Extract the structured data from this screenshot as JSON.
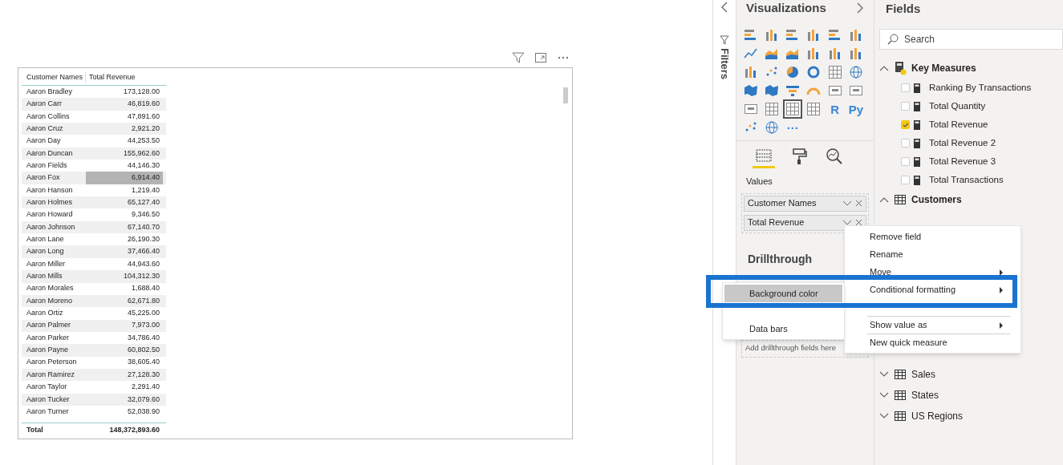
{
  "table": {
    "columns": [
      "Customer Names",
      "Total Revenue"
    ],
    "rows": [
      {
        "name": "Aaron Bradley",
        "value": "173,128.00",
        "selected": false
      },
      {
        "name": "Aaron Carr",
        "value": "46,819.60",
        "selected": false
      },
      {
        "name": "Aaron Collins",
        "value": "47,891.60",
        "selected": false
      },
      {
        "name": "Aaron Cruz",
        "value": "2,921.20",
        "selected": false
      },
      {
        "name": "Aaron Day",
        "value": "44,253.50",
        "selected": false
      },
      {
        "name": "Aaron Duncan",
        "value": "155,962.60",
        "selected": false
      },
      {
        "name": "Aaron Fields",
        "value": "44,146.30",
        "selected": false
      },
      {
        "name": "Aaron Fox",
        "value": "6,914.40",
        "selected": true
      },
      {
        "name": "Aaron Hanson",
        "value": "1,219.40",
        "selected": false
      },
      {
        "name": "Aaron Holmes",
        "value": "65,127.40",
        "selected": false
      },
      {
        "name": "Aaron Howard",
        "value": "9,346.50",
        "selected": false
      },
      {
        "name": "Aaron Johnson",
        "value": "67,140.70",
        "selected": false
      },
      {
        "name": "Aaron Lane",
        "value": "26,190.30",
        "selected": false
      },
      {
        "name": "Aaron Long",
        "value": "37,466.40",
        "selected": false
      },
      {
        "name": "Aaron Miller",
        "value": "44,943.60",
        "selected": false
      },
      {
        "name": "Aaron Mills",
        "value": "104,312.30",
        "selected": false
      },
      {
        "name": "Aaron Morales",
        "value": "1,688.40",
        "selected": false
      },
      {
        "name": "Aaron Moreno",
        "value": "62,671.80",
        "selected": false
      },
      {
        "name": "Aaron Ortiz",
        "value": "45,225.00",
        "selected": false
      },
      {
        "name": "Aaron Palmer",
        "value": "7,973.00",
        "selected": false
      },
      {
        "name": "Aaron Parker",
        "value": "34,786.40",
        "selected": false
      },
      {
        "name": "Aaron Payne",
        "value": "60,802.50",
        "selected": false
      },
      {
        "name": "Aaron Peterson",
        "value": "38,605.40",
        "selected": false
      },
      {
        "name": "Aaron Ramirez",
        "value": "27,128.30",
        "selected": false
      },
      {
        "name": "Aaron Taylor",
        "value": "2,291.40",
        "selected": false
      },
      {
        "name": "Aaron Tucker",
        "value": "32,079.60",
        "selected": false
      },
      {
        "name": "Aaron Turner",
        "value": "52,038.90",
        "selected": false
      }
    ],
    "total": {
      "label": "Total",
      "value": "148,372,893.60"
    }
  },
  "filters": {
    "title": "Filters"
  },
  "visualizations": {
    "title": "Visualizations",
    "icons": [
      {
        "kind": "hbar",
        "selected": false
      },
      {
        "kind": "vbar",
        "selected": false
      },
      {
        "kind": "hbar",
        "selected": false
      },
      {
        "kind": "vbar",
        "selected": false
      },
      {
        "kind": "hbar",
        "selected": false
      },
      {
        "kind": "vbar",
        "selected": false
      },
      {
        "kind": "line",
        "selected": false
      },
      {
        "kind": "area",
        "selected": false
      },
      {
        "kind": "area",
        "selected": false
      },
      {
        "kind": "vbar",
        "selected": false
      },
      {
        "kind": "vbar",
        "selected": false
      },
      {
        "kind": "vbar",
        "selected": false
      },
      {
        "kind": "vbar",
        "selected": false
      },
      {
        "kind": "scatter",
        "selected": false
      },
      {
        "kind": "pie",
        "selected": false
      },
      {
        "kind": "donut",
        "selected": false
      },
      {
        "kind": "grid",
        "selected": false
      },
      {
        "kind": "globe",
        "selected": false
      },
      {
        "kind": "map",
        "selected": false
      },
      {
        "kind": "map",
        "selected": false
      },
      {
        "kind": "funnel",
        "selected": false
      },
      {
        "kind": "gauge",
        "selected": false
      },
      {
        "kind": "card",
        "selected": false
      },
      {
        "kind": "card",
        "selected": false
      },
      {
        "kind": "card",
        "selected": false
      },
      {
        "kind": "grid",
        "selected": false
      },
      {
        "kind": "grid",
        "selected": true
      },
      {
        "kind": "grid",
        "selected": false
      },
      {
        "kind": "text",
        "label": "R",
        "selected": false
      },
      {
        "kind": "text",
        "label": "Py",
        "selected": false
      },
      {
        "kind": "scatter",
        "selected": false
      },
      {
        "kind": "globe",
        "selected": false
      },
      {
        "kind": "text",
        "label": "···",
        "selected": false
      }
    ],
    "tabs": [
      {
        "kind": "fields",
        "selected": true
      },
      {
        "kind": "format",
        "selected": false
      },
      {
        "kind": "analytics",
        "selected": false
      }
    ],
    "values_label": "Values",
    "wells": [
      "Customer Names",
      "Total Revenue"
    ],
    "drillthrough": {
      "title": "Drillthrough",
      "placeholder": "Add drillthrough fields here"
    }
  },
  "fields": {
    "title": "Fields",
    "search": {
      "placeholder": "Search"
    },
    "tables": [
      {
        "name": "Key Measures",
        "kind": "measures",
        "expanded": true,
        "children": [
          {
            "name": "Ranking By Transactions",
            "checked": false
          },
          {
            "name": "Total Quantity",
            "checked": false
          },
          {
            "name": "Total Revenue",
            "checked": true
          },
          {
            "name": "Total Revenue 2",
            "checked": false
          },
          {
            "name": "Total Revenue 3",
            "checked": false
          },
          {
            "name": "Total Transactions",
            "checked": false
          }
        ]
      },
      {
        "name": "Customers",
        "kind": "table",
        "expanded": true
      },
      {
        "name": "Sales",
        "kind": "table",
        "expanded": false
      },
      {
        "name": "States",
        "kind": "table",
        "expanded": false
      },
      {
        "name": "US Regions",
        "kind": "table",
        "expanded": false
      }
    ]
  },
  "context_menu": {
    "items": [
      {
        "label": "Remove field",
        "submenu": false,
        "divider": false
      },
      {
        "label": "Rename",
        "submenu": false,
        "divider": false
      },
      {
        "label": "Move",
        "submenu": true,
        "divider": false
      },
      {
        "label": "Conditional formatting",
        "submenu": true,
        "divider": false
      },
      {
        "label": "Show value as",
        "submenu": true,
        "divider": true
      },
      {
        "label": "New quick measure",
        "submenu": false,
        "divider": true
      }
    ]
  },
  "submenu": {
    "items": [
      {
        "label": "Background color",
        "selected": true
      },
      {
        "label": "Data bars",
        "selected": false
      }
    ]
  }
}
